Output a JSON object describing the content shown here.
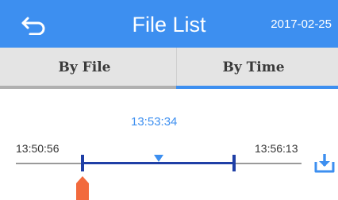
{
  "header": {
    "title": "File List",
    "date": "2017-02-25",
    "back_icon": "back-arrow-icon",
    "background_color": "#3d8ff0"
  },
  "tabs": [
    {
      "label": "By File",
      "selected": false
    },
    {
      "label": "By Time",
      "selected": true
    }
  ],
  "timeline": {
    "current_time": "13:53:34",
    "start_time": "13:50:56",
    "end_time": "13:56:13",
    "range_color": "#1f3fa6",
    "pin_color": "#f26a3d",
    "download_icon": "download-icon"
  }
}
